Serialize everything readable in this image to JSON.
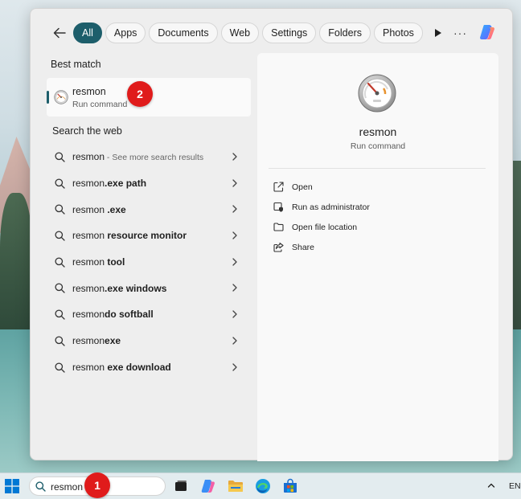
{
  "filters": {
    "chips": [
      {
        "label": "All",
        "active": true
      },
      {
        "label": "Apps"
      },
      {
        "label": "Documents"
      },
      {
        "label": "Web"
      },
      {
        "label": "Settings"
      },
      {
        "label": "Folders"
      },
      {
        "label": "Photos"
      }
    ],
    "more_label": "···"
  },
  "results": {
    "best_match_title": "Best match",
    "best_match": {
      "name": "resmon",
      "type": "Run command"
    },
    "web_title": "Search the web",
    "web": [
      {
        "prefix": "resmon",
        "bold": "",
        "hint": " - See more search results"
      },
      {
        "prefix": "resmon",
        "bold": ".exe path",
        "hint": ""
      },
      {
        "prefix": "resmon",
        "bold": " .exe",
        "hint": ""
      },
      {
        "prefix": "resmon",
        "bold": " resource monitor",
        "hint": ""
      },
      {
        "prefix": "resmon",
        "bold": " tool",
        "hint": ""
      },
      {
        "prefix": "resmon",
        "bold": ".exe windows",
        "hint": ""
      },
      {
        "prefix": "resmon",
        "bold": "do softball",
        "hint": ""
      },
      {
        "prefix": "resmon",
        "bold": "exe",
        "hint": ""
      },
      {
        "prefix": "resmon",
        "bold": " exe download",
        "hint": ""
      }
    ]
  },
  "detail": {
    "title": "resmon",
    "subtitle": "Run command",
    "actions": [
      {
        "label": "Open",
        "icon": "open-external-icon"
      },
      {
        "label": "Run as administrator",
        "icon": "shield-admin-icon"
      },
      {
        "label": "Open file location",
        "icon": "folder-icon"
      },
      {
        "label": "Share",
        "icon": "share-icon"
      }
    ]
  },
  "annotations": {
    "badge1": "1",
    "badge2": "2"
  },
  "taskbar": {
    "search_value": "resmon",
    "lang": "ENG"
  },
  "colors": {
    "accent": "#1d5e6b",
    "badge": "#e01b1b"
  }
}
